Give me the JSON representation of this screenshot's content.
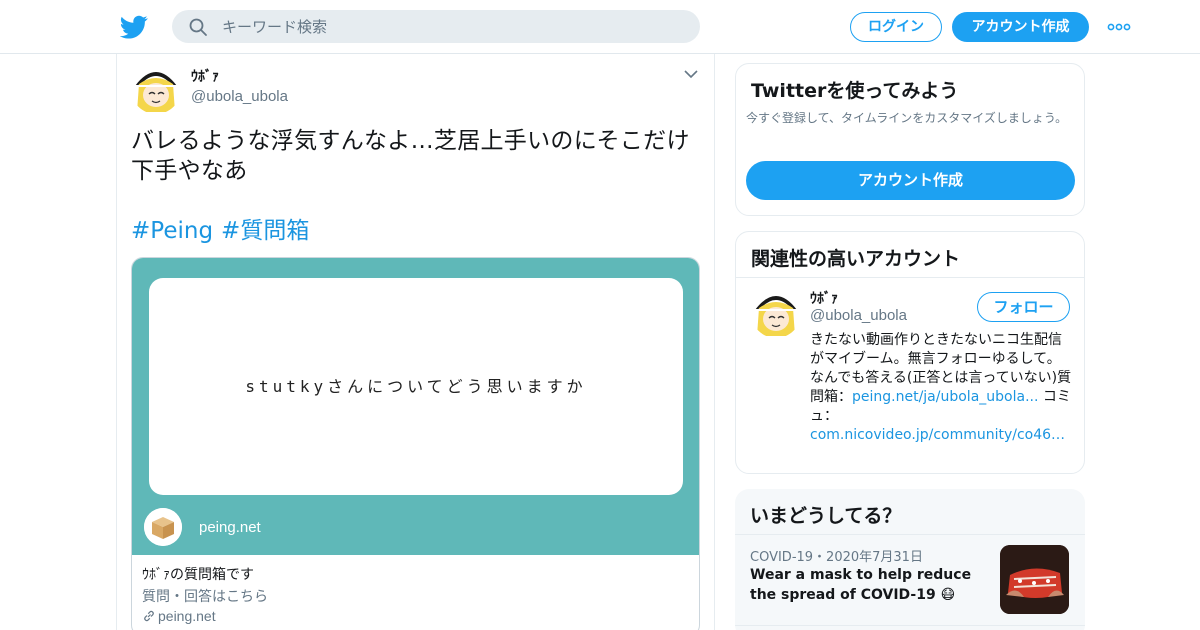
{
  "header": {
    "search_placeholder": "キーワード検索",
    "login_label": "ログイン",
    "signup_label": "アカウント作成"
  },
  "tweet": {
    "name": "ｳﾎﾞｧ",
    "handle": "@ubola_ubola",
    "text": "バレるような浮気すんなよ…芝居上手いのにそこだけ下手やなあ",
    "hashtags": [
      "#Peing",
      "#質問箱"
    ],
    "card": {
      "question": "stutkyさんについてどう思いますか",
      "site": "peing.net",
      "title": "ｳﾎﾞｧの質問箱です",
      "description": "質問・回答はこちら",
      "domain": "peing.net"
    }
  },
  "try_panel": {
    "title": "Twitterを使ってみよう",
    "subtitle": "今すぐ登録して、タイムラインをカスタマイズしましょう。",
    "button_label": "アカウント作成"
  },
  "related": {
    "title": "関連性の高いアカウント",
    "name": "ｳﾎﾞｧ",
    "handle": "@ubola_ubola",
    "follow_label": "フォロー",
    "bio_text": "きたない動画作りときたないニコ生配信がマイブーム。無言フォローゆるして。 なんでも答える(正答とは言っていない)質問箱：",
    "bio_link1": "peing.net/ja/ubola_ubola...",
    "bio_mid": " コミュ：",
    "bio_link2": "com.nicovideo.jp/community/co46…"
  },
  "trends": {
    "title": "いまどうしてる？",
    "meta": "COVID-19・2020年7月31日",
    "text": "Wear a mask to help reduce the spread of COVID-19 😷"
  },
  "colors": {
    "accent": "#1da1f2",
    "card_bg": "#5fb8b8",
    "link": "#1b95e0"
  }
}
